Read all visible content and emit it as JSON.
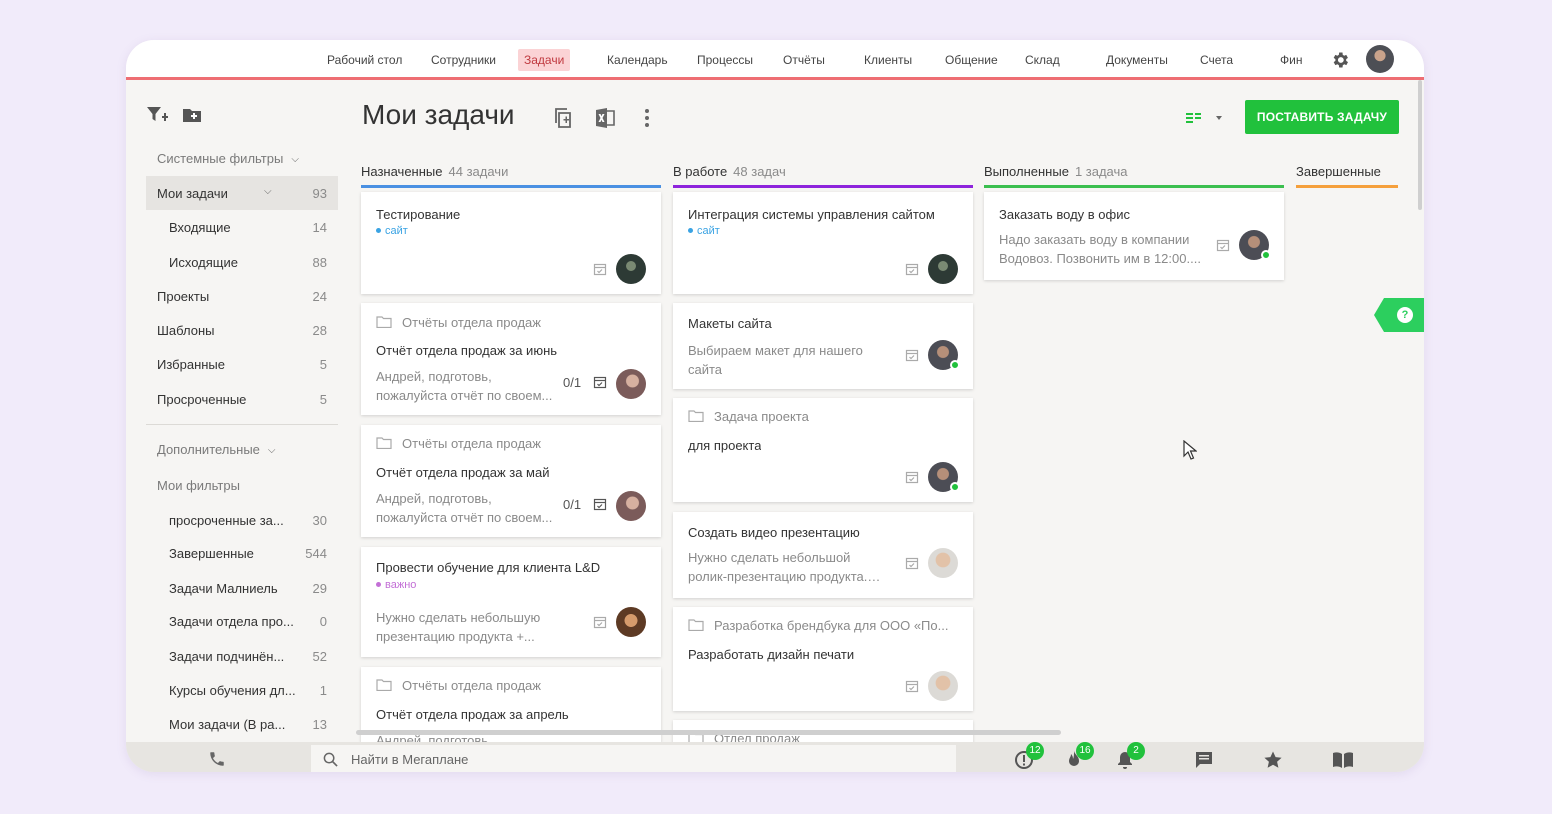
{
  "nav": {
    "items": [
      "Рабочий стол",
      "Сотрудники",
      "Задачи",
      "Календарь",
      "Процессы",
      "Отчёты",
      "Клиенты",
      "Общение",
      "Склад",
      "Документы",
      "Счета",
      "Фин"
    ],
    "active": "Задачи",
    "settings_icon": "gear-icon"
  },
  "sidebar": {
    "system_filters": "Системные фильтры",
    "items": [
      {
        "label": "Мои задачи",
        "count": "93"
      },
      {
        "label": "Входящие",
        "count": "14"
      },
      {
        "label": "Исходящие",
        "count": "88"
      },
      {
        "label": "Проекты",
        "count": "24"
      },
      {
        "label": "Шаблоны",
        "count": "28"
      },
      {
        "label": "Избранные",
        "count": "5"
      },
      {
        "label": "Просроченные",
        "count": "5"
      }
    ],
    "additional": "Дополнительные",
    "my_filters": "Мои фильтры",
    "filters": [
      {
        "label": "просроченные за...",
        "count": "30"
      },
      {
        "label": "Завершенные",
        "count": "544"
      },
      {
        "label": "Задачи Малниель",
        "count": "29"
      },
      {
        "label": "Задачи отдела про...",
        "count": "0"
      },
      {
        "label": "Задачи подчинён...",
        "count": "52"
      },
      {
        "label": "Курсы обучения дл...",
        "count": "1"
      },
      {
        "label": "Мои задачи (В ра...",
        "count": "13"
      }
    ]
  },
  "header": {
    "title": "Мои задачи",
    "add_task": "ПОСТАВИТЬ ЗАДАЧУ"
  },
  "columns": [
    {
      "title": "Назначенные",
      "count": "44 задачи",
      "color": "#4a90e2"
    },
    {
      "title": "В работе",
      "count": "48 задач",
      "color": "#8e24dc"
    },
    {
      "title": "Выполненные",
      "count": "1 задача",
      "color": "#3bbf4f"
    },
    {
      "title": "Завершенные",
      "count": "",
      "color": "#f5a03c"
    }
  ],
  "cards": {
    "assigned": [
      {
        "title": "Тестирование",
        "tag": "сайт",
        "tag_color": "#3aa3e3"
      },
      {
        "project": "Отчёты отдела продаж",
        "title": "Отчёт отдела продаж за июнь",
        "desc1": "Андрей, подготовь,",
        "desc2": "пожалуйста отчёт по своем...",
        "progress": "0/1"
      },
      {
        "project": "Отчёты отдела продаж",
        "title": "Отчёт отдела продаж за май",
        "desc1": "Андрей, подготовь,",
        "desc2": "пожалуйста отчёт по своем...",
        "progress": "0/1"
      },
      {
        "title": "Провести обучение для клиента L&D",
        "tag": "важно",
        "tag_color": "#c36fd6",
        "desc1": "Нужно сделать небольшую",
        "desc2": "презентацию продукта +..."
      },
      {
        "project": "Отчёты отдела продаж",
        "title": "Отчёт отдела продаж за апрель",
        "desc1": "Андрей, подготовь,"
      }
    ],
    "in_progress": [
      {
        "title": "Интеграция системы управления сайтом",
        "tag": "сайт",
        "tag_color": "#3aa3e3"
      },
      {
        "title": "Макеты сайта",
        "desc1": "Выбираем макет для нашего",
        "desc2": "сайта"
      },
      {
        "project": "Задача проекта",
        "title": "для проекта"
      },
      {
        "title": "Создать видео презентацию",
        "desc1": "Нужно сделать небольшой",
        "desc2": "ролик-презентацию продукта. П..."
      },
      {
        "project": "Разработка брендбука для ООО «По...",
        "title": "Разработать дизайн печати"
      },
      {
        "project": "Отдел продаж"
      }
    ],
    "done": [
      {
        "title": "Заказать воду в офис",
        "desc1": "Надо заказать воду в компании",
        "desc2": "Водовоз. Позвонить им в 12:00...."
      }
    ]
  },
  "bottom": {
    "search_placeholder": "Найти в Мегаплане",
    "badges": {
      "alerts": "12",
      "hot": "16",
      "notifications": "2"
    }
  },
  "colors": {
    "accent": "#21c13c",
    "nav_border": "#ee6e73"
  }
}
